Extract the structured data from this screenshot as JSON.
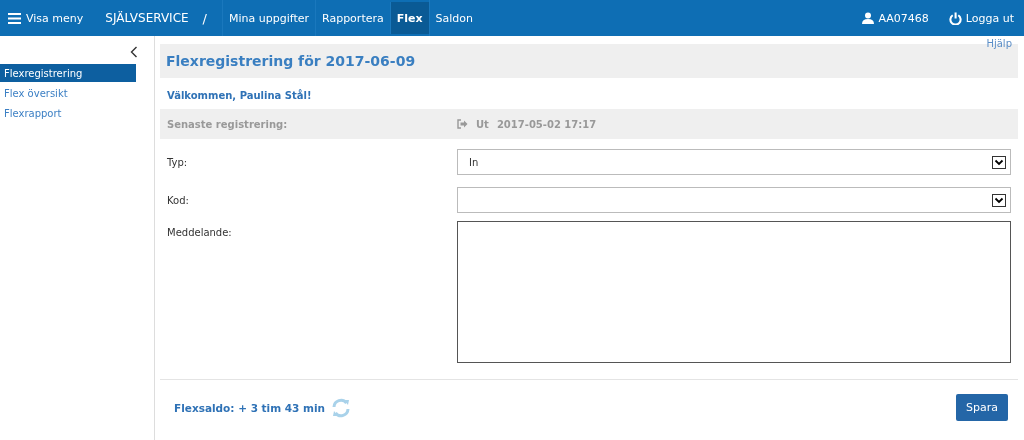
{
  "topbar": {
    "menu_label": "Visa meny",
    "brand": "SJÄLVSERVICE",
    "separator": "/",
    "nav": [
      {
        "label": "Mina uppgifter",
        "selected": false
      },
      {
        "label": "Rapportera",
        "selected": false
      },
      {
        "label": "Flex",
        "selected": true
      },
      {
        "label": "Saldon",
        "selected": false
      }
    ],
    "user": "AA07468",
    "logout": "Logga ut"
  },
  "sidebar": {
    "items": [
      {
        "label": "Flexregistrering",
        "selected": true
      },
      {
        "label": "Flex översikt",
        "selected": false
      },
      {
        "label": "Flexrapport",
        "selected": false
      }
    ]
  },
  "help": "Hjälp",
  "title": "Flexregistrering för 2017-06-09",
  "welcome": "Välkommen, Paulina Stål!",
  "last": {
    "label": "Senaste registrering:",
    "direction": "Ut",
    "time": "2017-05-02 17:17"
  },
  "form": [
    {
      "kind": "select",
      "label": "Typ:",
      "value": "In"
    },
    {
      "kind": "select",
      "label": "Kod:"
    },
    {
      "kind": "textarea",
      "label": "Meddelande:"
    }
  ],
  "balance": "Flexsaldo: + 3 tim 43 min",
  "save": "Spara"
}
